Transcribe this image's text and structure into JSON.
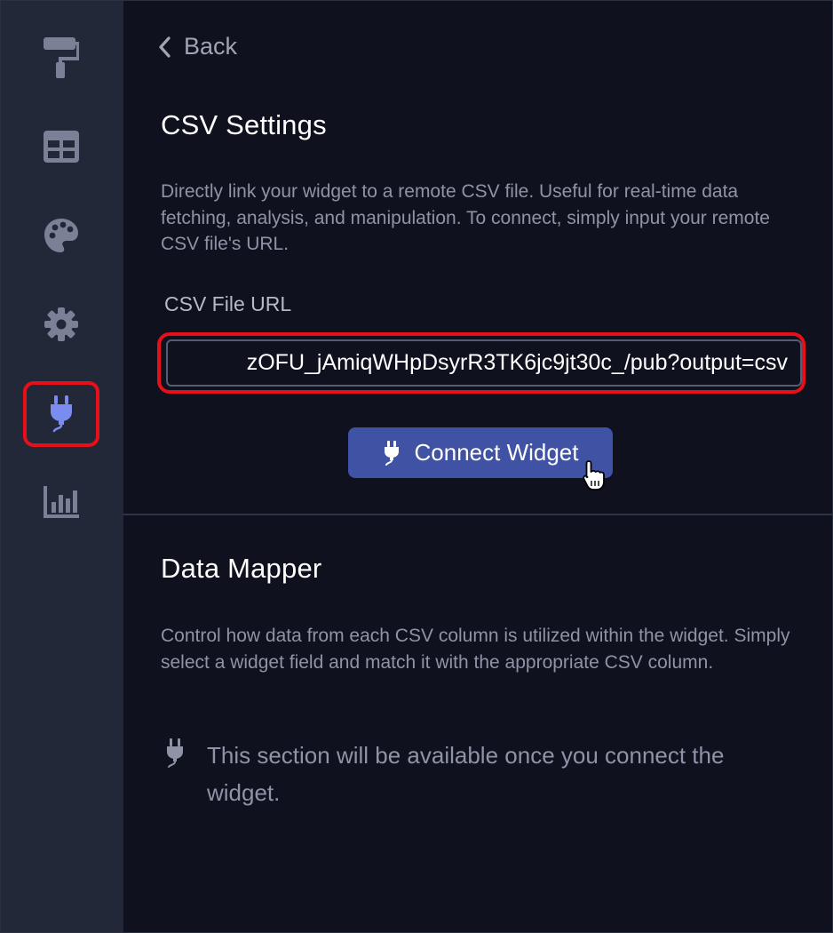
{
  "sidebar": {
    "items": [
      {
        "icon": "paint-roller-icon"
      },
      {
        "icon": "table-icon"
      },
      {
        "icon": "palette-icon"
      },
      {
        "icon": "gear-icon"
      },
      {
        "icon": "plug-icon",
        "active": true
      },
      {
        "icon": "bar-chart-icon"
      }
    ]
  },
  "header": {
    "back_label": "Back"
  },
  "csv_settings": {
    "title": "CSV Settings",
    "description": "Directly link your widget to a remote CSV file. Useful for real-time data fetching, analysis, and manipulation. To connect, simply input your remote CSV file's URL.",
    "url_label": "CSV File URL",
    "url_value": "zOFU_jAmiqWHpDsyrR3TK6jc9jt30c_/pub?output=csv",
    "connect_button_label": "Connect Widget"
  },
  "data_mapper": {
    "title": "Data Mapper",
    "description": "Control how data from each CSV column is utilized within the widget. Simply select a widget field and match it with the appropriate CSV column.",
    "notice": "This section will be available once you connect the widget."
  },
  "colors": {
    "background": "#0f111e",
    "sidebar": "#222838",
    "accent": "#4052a3",
    "highlight": "#e80f18",
    "active_icon": "#7b8cf0",
    "inactive_icon": "#7a8196"
  }
}
